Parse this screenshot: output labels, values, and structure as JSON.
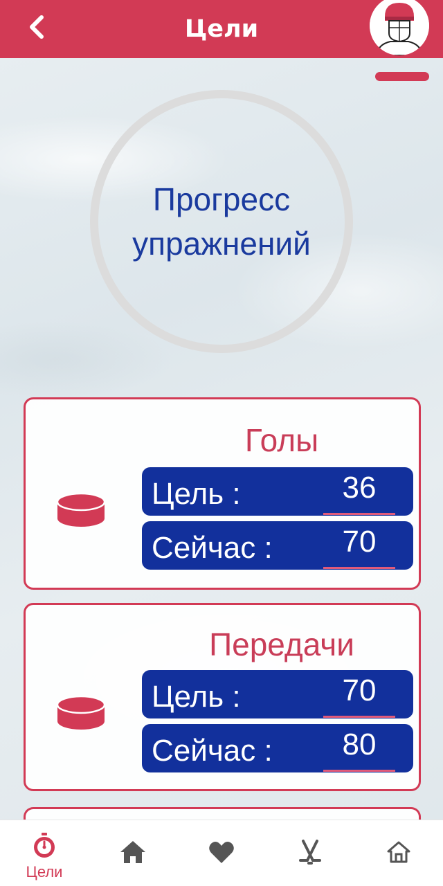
{
  "header": {
    "title": "Цели",
    "back_icon": "chevron-left-icon",
    "avatar_icon": "hockey-player-avatar-icon"
  },
  "progress": {
    "label": "Прогресс упражнений"
  },
  "goals": [
    {
      "title": "Голы",
      "icon": "puck-icon",
      "target_label": "Цель :",
      "target_value": "36",
      "current_label": "Сейчас :",
      "current_value": "70"
    },
    {
      "title": "Передачи",
      "icon": "puck-icon",
      "target_label": "Цель :",
      "target_value": "70",
      "current_label": "Сейчас :",
      "current_value": "80"
    }
  ],
  "bottom_nav": {
    "items": [
      {
        "icon": "stopwatch-icon",
        "label": "Цели",
        "active": true
      },
      {
        "icon": "home-icon",
        "label": "",
        "active": false
      },
      {
        "icon": "heart-icon",
        "label": "",
        "active": false
      },
      {
        "icon": "hockey-sticks-icon",
        "label": "",
        "active": false
      },
      {
        "icon": "home-outline-icon",
        "label": "",
        "active": false
      }
    ]
  },
  "colors": {
    "primary": "#d23a55",
    "navy": "#12309c",
    "progress_text": "#1a3a9e",
    "ring": "#dcdcdc"
  }
}
